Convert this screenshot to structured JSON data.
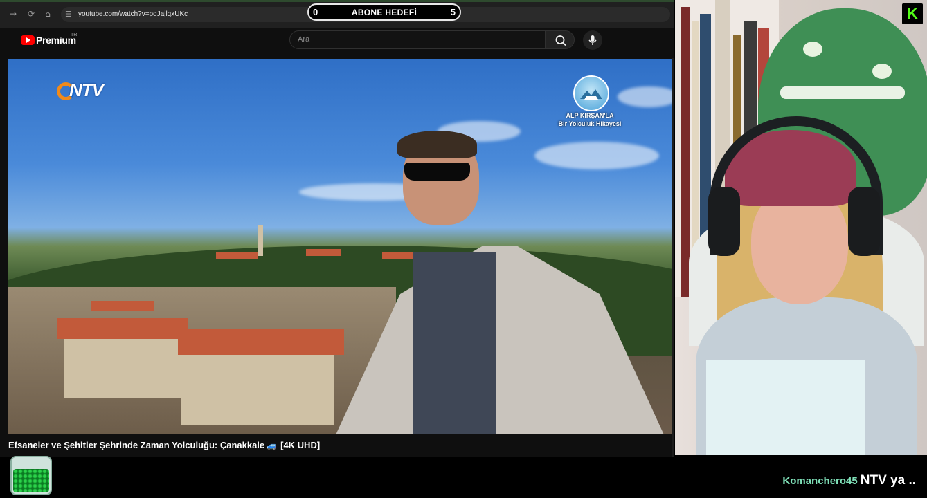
{
  "browser": {
    "url": "youtube.com/watch?v=pqJajlqxUKc",
    "back_icon": "arrow-right-icon",
    "reload_icon": "reload-icon",
    "home_icon": "home-icon",
    "site_info_icon": "site-settings-icon"
  },
  "sub_goal": {
    "min": "0",
    "title": "ABONE HEDEFİ",
    "max": "5"
  },
  "youtube": {
    "brand": "Premium",
    "country": "TR",
    "search_placeholder": "Ara",
    "search_icon": "search-icon",
    "mic_icon": "microphone-icon"
  },
  "video": {
    "channel_logo": "NTV",
    "badge_title": "ALP KIRŞAN'LA",
    "badge_subtitle": "Bir Yolculuk Hikayesi",
    "title_part1": "Efsaneler ve Şehitler Şehrinde Zaman Yolculuğu: Çanakkale",
    "title_icon": "🚙",
    "title_part2": "[4K UHD]"
  },
  "stream": {
    "platform_badge": "K",
    "chat_user": "Komanchero45",
    "chat_message": "NTV ya .."
  },
  "colors": {
    "kick_green": "#53fc18",
    "youtube_red": "#ff0000",
    "chat_user": "#7fe0b8"
  }
}
